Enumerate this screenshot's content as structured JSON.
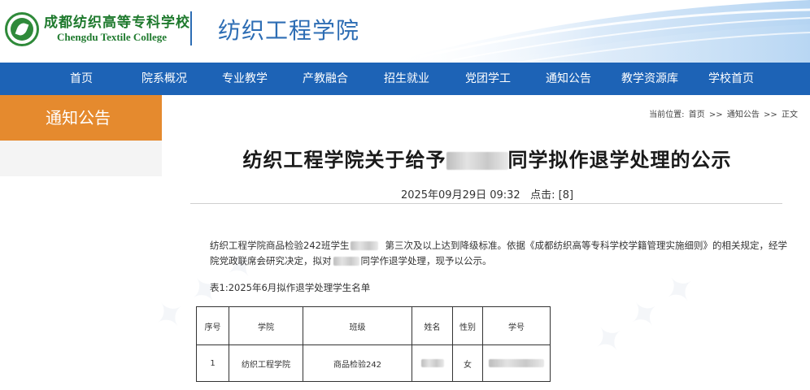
{
  "header": {
    "logo_cn": "成都纺织高等专科学校",
    "logo_en": "Chengdu Textile College",
    "site_title": "纺织工程学院"
  },
  "nav": {
    "items": [
      "首页",
      "院系概况",
      "专业教学",
      "产教融合",
      "招生就业",
      "党团学工",
      "通知公告",
      "教学资源库",
      "学校首页"
    ]
  },
  "sidebar": {
    "heading": "通知公告"
  },
  "breadcrumb": {
    "prefix": "当前位置:",
    "items": [
      "首页",
      "通知公告",
      "正文"
    ],
    "separator": ">>"
  },
  "article": {
    "title_before": "纺织工程学院关于给予",
    "title_after": "同学拟作退学处理的公示",
    "date": "2025年09月29日 09:32",
    "clicks_label": "点击:",
    "clicks_value": "[8]",
    "para_part1": "纺织工程学院商品检验242班学生",
    "para_part2": "第三次及以上达到降级标准。依据《成都纺织高等专科学校学籍管理实施细则》的相关规定，经学",
    "para_line2_part1": "院党政联席会研究决定，拟对",
    "para_line2_part2": "同学作退学处理，现予以公示。",
    "table_caption": "表1:2025年6月拟作退学处理学生名单"
  },
  "table": {
    "headers": [
      "序号",
      "学院",
      "班级",
      "姓名",
      "性别",
      "学号"
    ],
    "rows": [
      [
        "1",
        "纺织工程学院",
        "商品检验242",
        "",
        "女",
        ""
      ]
    ]
  },
  "colors": {
    "nav_bg": "#1d63b6",
    "sidebar_accent": "#e58a2e",
    "title_blue": "#2d6db4",
    "logo_green": "#1f7a2e"
  }
}
